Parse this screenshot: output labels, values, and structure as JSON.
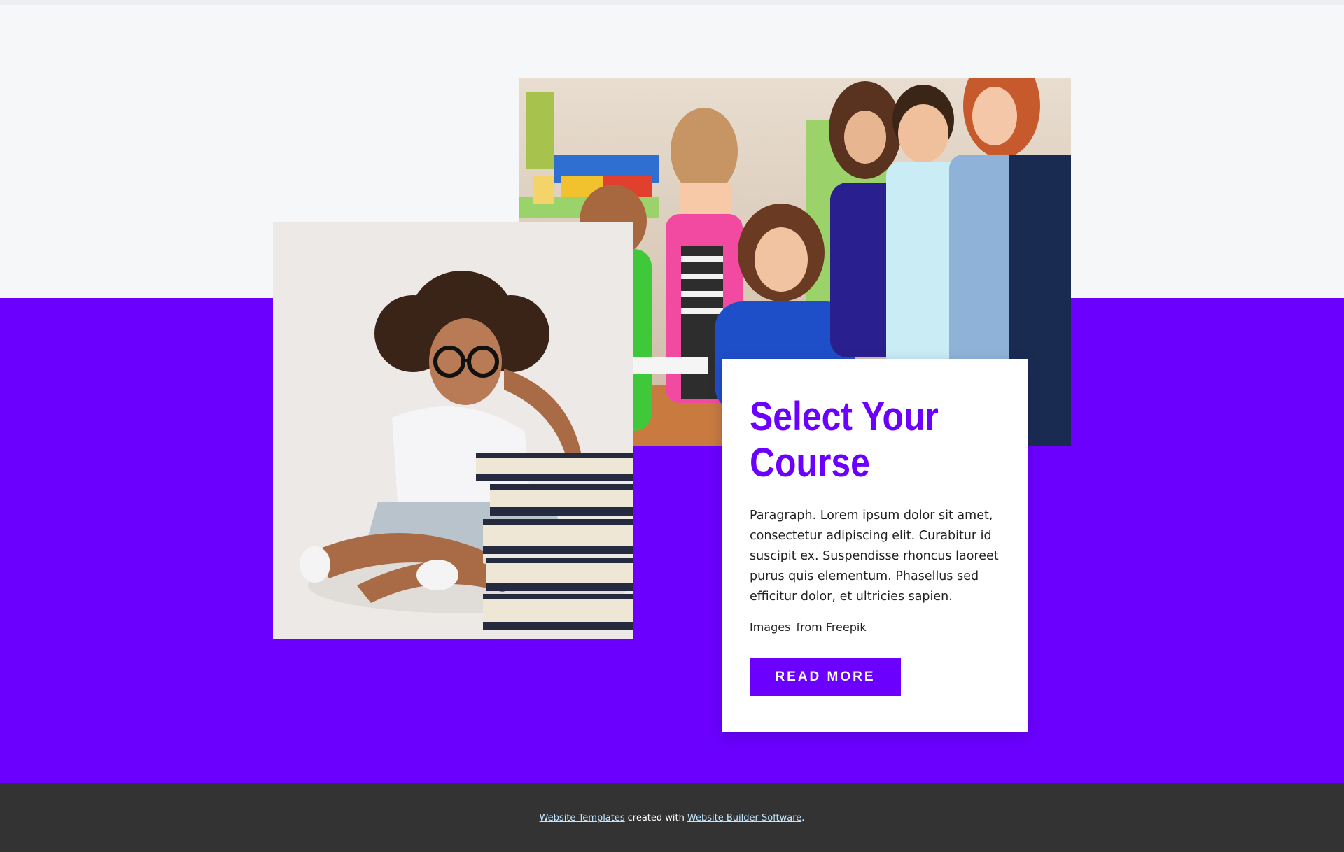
{
  "card": {
    "title": "Select Your Course",
    "paragraph": "Paragraph. Lorem ipsum dolor sit amet, consectetur adipiscing elit. Curabitur id suscipit ex. Suspendisse rhoncus laoreet purus quis elementum. Phasellus sed efficitur dolor, et ultricies sapien.",
    "credit_prefix": "Images",
    "credit_from": "from",
    "credit_link": "Freepik",
    "button_label": "READ MORE"
  },
  "footer": {
    "link1": "Website Templates",
    "middle": "created with",
    "link2": "Website Builder Software",
    "end": "."
  },
  "colors": {
    "accent": "#6b00ff",
    "page_background": "#f6f7f9",
    "footer_background": "#333333",
    "card_background": "#ffffff"
  }
}
